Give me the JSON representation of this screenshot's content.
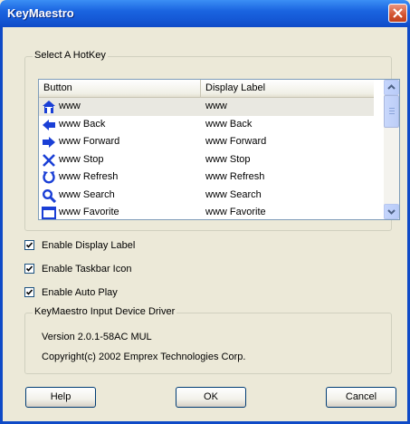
{
  "window": {
    "title": "KeyMaestro"
  },
  "hotkey_group": {
    "title": "Select A HotKey",
    "columns": [
      "Button",
      "Display Label"
    ],
    "rows": [
      {
        "icon": "home-icon",
        "button": "www",
        "label": "www"
      },
      {
        "icon": "back-arrow-icon",
        "button": "www Back",
        "label": "www Back"
      },
      {
        "icon": "forward-arrow-icon",
        "button": "www Forward",
        "label": "www Forward"
      },
      {
        "icon": "stop-x-icon",
        "button": "www Stop",
        "label": "www Stop"
      },
      {
        "icon": "refresh-icon",
        "button": "www Refresh",
        "label": "www Refresh"
      },
      {
        "icon": "search-magnifier-icon",
        "button": "www Search",
        "label": "www Search"
      },
      {
        "icon": "favorites-icon",
        "button": "www Favorite",
        "label": "www Favorite"
      }
    ]
  },
  "options": [
    {
      "label": "Enable Display Label",
      "checked": true
    },
    {
      "label": "Enable Taskbar Icon",
      "checked": true
    },
    {
      "label": "Enable Auto Play",
      "checked": true
    }
  ],
  "driver_group": {
    "title": "KeyMaestro Input Device Driver",
    "version": "Version 2.0.1-58AC MUL",
    "copyright": "Copyright(c) 2002 Emprex Technologies Corp."
  },
  "buttons": {
    "help": "Help",
    "ok": "OK",
    "cancel": "Cancel"
  },
  "colors": {
    "titlebar": "#1559d6",
    "window_bg": "#ECE9D8",
    "close": "#d2532f",
    "icon_blue": "#1a3fd6"
  }
}
